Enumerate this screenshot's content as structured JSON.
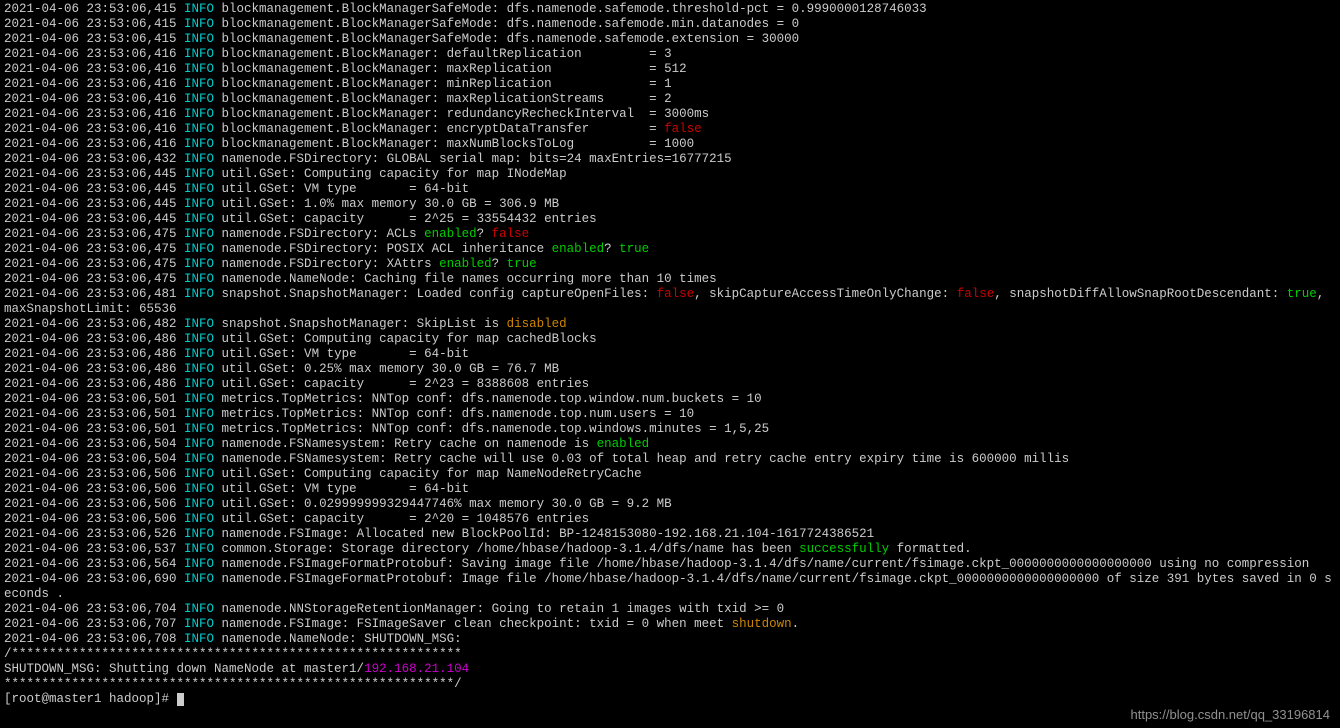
{
  "watermark": "https://blog.csdn.net/qq_33196814",
  "prompt": "[root@master1 hadoop]# ",
  "divider": "/************************************************************",
  "shutdown_line_prefix": "SHUTDOWN_MSG: Shutting down NameNode at master1/",
  "shutdown_ip": "192.168.21.104",
  "divider_end": "************************************************************/",
  "lines": [
    {
      "ts": "2021-04-06 23:53:06,415",
      "lv": "INFO",
      "seg": [
        {
          "t": " blockmanagement.BlockManagerSafeMode: dfs.namenode.safemode.threshold-pct = 0.9990000128746033"
        }
      ]
    },
    {
      "ts": "2021-04-06 23:53:06,415",
      "lv": "INFO",
      "seg": [
        {
          "t": " blockmanagement.BlockManagerSafeMode: dfs.namenode.safemode.min.datanodes = 0"
        }
      ]
    },
    {
      "ts": "2021-04-06 23:53:06,415",
      "lv": "INFO",
      "seg": [
        {
          "t": " blockmanagement.BlockManagerSafeMode: dfs.namenode.safemode.extension = 30000"
        }
      ]
    },
    {
      "ts": "2021-04-06 23:53:06,416",
      "lv": "INFO",
      "seg": [
        {
          "t": " blockmanagement.BlockManager: defaultReplication         = 3"
        }
      ]
    },
    {
      "ts": "2021-04-06 23:53:06,416",
      "lv": "INFO",
      "seg": [
        {
          "t": " blockmanagement.BlockManager: maxReplication             = 512"
        }
      ]
    },
    {
      "ts": "2021-04-06 23:53:06,416",
      "lv": "INFO",
      "seg": [
        {
          "t": " blockmanagement.BlockManager: minReplication             = 1"
        }
      ]
    },
    {
      "ts": "2021-04-06 23:53:06,416",
      "lv": "INFO",
      "seg": [
        {
          "t": " blockmanagement.BlockManager: maxReplicationStreams      = 2"
        }
      ]
    },
    {
      "ts": "2021-04-06 23:53:06,416",
      "lv": "INFO",
      "seg": [
        {
          "t": " blockmanagement.BlockManager: redundancyRecheckInterval  = 3000ms"
        }
      ]
    },
    {
      "ts": "2021-04-06 23:53:06,416",
      "lv": "INFO",
      "seg": [
        {
          "t": " blockmanagement.BlockManager: encryptDataTransfer        = "
        },
        {
          "t": "false",
          "c": "red"
        }
      ]
    },
    {
      "ts": "2021-04-06 23:53:06,416",
      "lv": "INFO",
      "seg": [
        {
          "t": " blockmanagement.BlockManager: maxNumBlocksToLog          = 1000"
        }
      ]
    },
    {
      "ts": "2021-04-06 23:53:06,432",
      "lv": "INFO",
      "seg": [
        {
          "t": " namenode.FSDirectory: GLOBAL serial map: bits=24 maxEntries=16777215"
        }
      ]
    },
    {
      "ts": "2021-04-06 23:53:06,445",
      "lv": "INFO",
      "seg": [
        {
          "t": " util.GSet: Computing capacity for map INodeMap"
        }
      ]
    },
    {
      "ts": "2021-04-06 23:53:06,445",
      "lv": "INFO",
      "seg": [
        {
          "t": " util.GSet: VM type       = 64-bit"
        }
      ]
    },
    {
      "ts": "2021-04-06 23:53:06,445",
      "lv": "INFO",
      "seg": [
        {
          "t": " util.GSet: 1.0% max memory 30.0 GB = 306.9 MB"
        }
      ]
    },
    {
      "ts": "2021-04-06 23:53:06,445",
      "lv": "INFO",
      "seg": [
        {
          "t": " util.GSet: capacity      = 2^25 = 33554432 entries"
        }
      ]
    },
    {
      "ts": "2021-04-06 23:53:06,475",
      "lv": "INFO",
      "seg": [
        {
          "t": " namenode.FSDirectory: ACLs "
        },
        {
          "t": "enabled",
          "c": "green"
        },
        {
          "t": "? "
        },
        {
          "t": "false",
          "c": "red"
        }
      ]
    },
    {
      "ts": "2021-04-06 23:53:06,475",
      "lv": "INFO",
      "seg": [
        {
          "t": " namenode.FSDirectory: POSIX ACL inheritance "
        },
        {
          "t": "enabled",
          "c": "green"
        },
        {
          "t": "? "
        },
        {
          "t": "true",
          "c": "green"
        }
      ]
    },
    {
      "ts": "2021-04-06 23:53:06,475",
      "lv": "INFO",
      "seg": [
        {
          "t": " namenode.FSDirectory: XAttrs "
        },
        {
          "t": "enabled",
          "c": "green"
        },
        {
          "t": "? "
        },
        {
          "t": "true",
          "c": "green"
        }
      ]
    },
    {
      "ts": "2021-04-06 23:53:06,475",
      "lv": "INFO",
      "seg": [
        {
          "t": " namenode.NameNode: Caching file names occurring more than 10 times"
        }
      ]
    },
    {
      "ts": "2021-04-06 23:53:06,481",
      "lv": "INFO",
      "seg": [
        {
          "t": " snapshot.SnapshotManager: Loaded config captureOpenFiles: "
        },
        {
          "t": "false",
          "c": "red"
        },
        {
          "t": ", skipCaptureAccessTimeOnlyChange: "
        },
        {
          "t": "false",
          "c": "red"
        },
        {
          "t": ", snapshotDiffAllowSnapRootDescendant: "
        },
        {
          "t": "true",
          "c": "green"
        },
        {
          "t": ", maxSnapshotLimit: 65536"
        }
      ],
      "wrap": true
    },
    {
      "ts": "2021-04-06 23:53:06,482",
      "lv": "INFO",
      "seg": [
        {
          "t": " snapshot.SnapshotManager: SkipList is "
        },
        {
          "t": "disabled",
          "c": "orange"
        }
      ]
    },
    {
      "ts": "2021-04-06 23:53:06,486",
      "lv": "INFO",
      "seg": [
        {
          "t": " util.GSet: Computing capacity for map cachedBlocks"
        }
      ]
    },
    {
      "ts": "2021-04-06 23:53:06,486",
      "lv": "INFO",
      "seg": [
        {
          "t": " util.GSet: VM type       = 64-bit"
        }
      ]
    },
    {
      "ts": "2021-04-06 23:53:06,486",
      "lv": "INFO",
      "seg": [
        {
          "t": " util.GSet: 0.25% max memory 30.0 GB = 76.7 MB"
        }
      ]
    },
    {
      "ts": "2021-04-06 23:53:06,486",
      "lv": "INFO",
      "seg": [
        {
          "t": " util.GSet: capacity      = 2^23 = 8388608 entries"
        }
      ]
    },
    {
      "ts": "2021-04-06 23:53:06,501",
      "lv": "INFO",
      "seg": [
        {
          "t": " metrics.TopMetrics: NNTop conf: dfs.namenode.top.window.num.buckets = 10"
        }
      ]
    },
    {
      "ts": "2021-04-06 23:53:06,501",
      "lv": "INFO",
      "seg": [
        {
          "t": " metrics.TopMetrics: NNTop conf: dfs.namenode.top.num.users = 10"
        }
      ]
    },
    {
      "ts": "2021-04-06 23:53:06,501",
      "lv": "INFO",
      "seg": [
        {
          "t": " metrics.TopMetrics: NNTop conf: dfs.namenode.top.windows.minutes = 1,5,25"
        }
      ]
    },
    {
      "ts": "2021-04-06 23:53:06,504",
      "lv": "INFO",
      "seg": [
        {
          "t": " namenode.FSNamesystem: Retry cache on namenode is "
        },
        {
          "t": "enabled",
          "c": "green"
        }
      ]
    },
    {
      "ts": "2021-04-06 23:53:06,504",
      "lv": "INFO",
      "seg": [
        {
          "t": " namenode.FSNamesystem: Retry cache will use 0.03 of total heap and retry cache entry expiry time is 600000 millis"
        }
      ]
    },
    {
      "ts": "2021-04-06 23:53:06,506",
      "lv": "INFO",
      "seg": [
        {
          "t": " util.GSet: Computing capacity for map NameNodeRetryCache"
        }
      ]
    },
    {
      "ts": "2021-04-06 23:53:06,506",
      "lv": "INFO",
      "seg": [
        {
          "t": " util.GSet: VM type       = 64-bit"
        }
      ]
    },
    {
      "ts": "2021-04-06 23:53:06,506",
      "lv": "INFO",
      "seg": [
        {
          "t": " util.GSet: 0.029999999329447746% max memory 30.0 GB = 9.2 MB"
        }
      ]
    },
    {
      "ts": "2021-04-06 23:53:06,506",
      "lv": "INFO",
      "seg": [
        {
          "t": " util.GSet: capacity      = 2^20 = 1048576 entries"
        }
      ]
    },
    {
      "ts": "2021-04-06 23:53:06,526",
      "lv": "INFO",
      "seg": [
        {
          "t": " namenode.FSImage: Allocated new BlockPoolId: BP-1248153080-192.168.21.104-1617724386521"
        }
      ]
    },
    {
      "ts": "2021-04-06 23:53:06,537",
      "lv": "INFO",
      "seg": [
        {
          "t": " common.Storage: Storage directory /home/hbase/hadoop-3.1.4/dfs/name has been "
        },
        {
          "t": "successfully",
          "c": "green"
        },
        {
          "t": " formatted."
        }
      ]
    },
    {
      "ts": "2021-04-06 23:53:06,564",
      "lv": "INFO",
      "seg": [
        {
          "t": " namenode.FSImageFormatProtobuf: Saving image file /home/hbase/hadoop-3.1.4/dfs/name/current/fsimage.ckpt_0000000000000000000 using no compression"
        }
      ],
      "wrap": true
    },
    {
      "ts": "2021-04-06 23:53:06,690",
      "lv": "INFO",
      "seg": [
        {
          "t": " namenode.FSImageFormatProtobuf: Image file /home/hbase/hadoop-3.1.4/dfs/name/current/fsimage.ckpt_0000000000000000000 of size 391 bytes saved in 0 seconds ."
        }
      ],
      "wrap": true
    },
    {
      "ts": "2021-04-06 23:53:06,704",
      "lv": "INFO",
      "seg": [
        {
          "t": " namenode.NNStorageRetentionManager: Going to retain 1 images with txid >= 0"
        }
      ]
    },
    {
      "ts": "2021-04-06 23:53:06,707",
      "lv": "INFO",
      "seg": [
        {
          "t": " namenode.FSImage: FSImageSaver clean checkpoint: txid = 0 when meet "
        },
        {
          "t": "shutdown",
          "c": "orange"
        },
        {
          "t": "."
        }
      ]
    },
    {
      "ts": "2021-04-06 23:53:06,708",
      "lv": "INFO",
      "seg": [
        {
          "t": " namenode.NameNode: SHUTDOWN_MSG:"
        }
      ]
    }
  ]
}
